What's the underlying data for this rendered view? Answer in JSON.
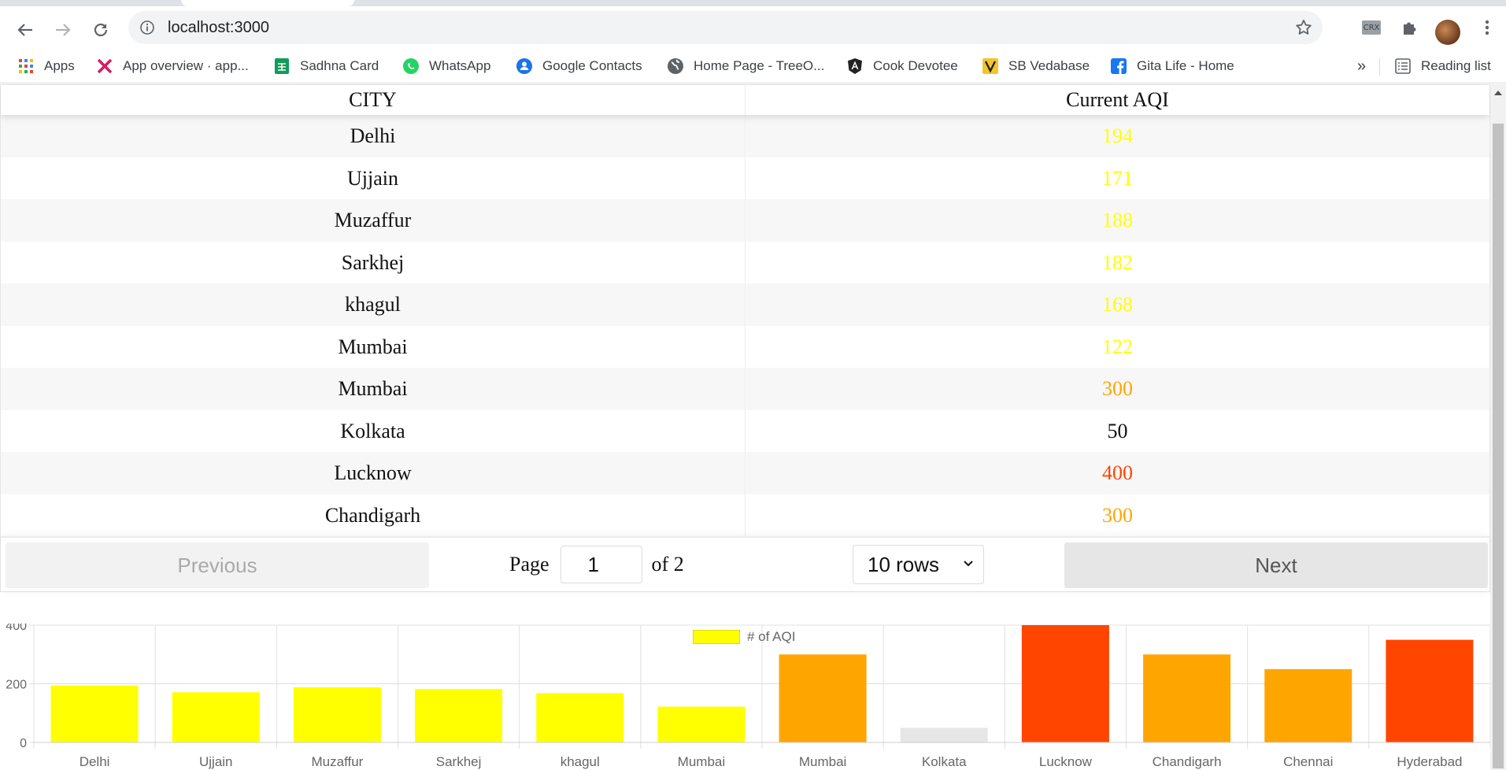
{
  "browser": {
    "url": "localhost:3000",
    "bookmarks": [
      {
        "label": "Apps",
        "icon": "apps-grid-icon"
      },
      {
        "label": "App overview · app...",
        "icon": "app-overview-icon"
      },
      {
        "label": "Sadhna Card",
        "icon": "sheets-icon"
      },
      {
        "label": "WhatsApp",
        "icon": "whatsapp-icon"
      },
      {
        "label": "Google Contacts",
        "icon": "contacts-icon"
      },
      {
        "label": "Home Page - TreeO...",
        "icon": "globe-icon"
      },
      {
        "label": "Cook Devotee",
        "icon": "angular-icon"
      },
      {
        "label": "SB Vedabase",
        "icon": "vedabase-icon"
      },
      {
        "label": "Gita Life - Home",
        "icon": "facebook-icon"
      }
    ],
    "overflow_label": "»",
    "reading_list_label": "Reading list",
    "extension_label": "CRX"
  },
  "table": {
    "headers": [
      "CITY",
      "Current AQI"
    ],
    "rows": [
      {
        "city": "Delhi",
        "aqi": "194",
        "color": "#ffff00"
      },
      {
        "city": "Ujjain",
        "aqi": "171",
        "color": "#ffff00"
      },
      {
        "city": "Muzaffur",
        "aqi": "188",
        "color": "#ffff00"
      },
      {
        "city": "Sarkhej",
        "aqi": "182",
        "color": "#ffff00"
      },
      {
        "city": "khagul",
        "aqi": "168",
        "color": "#ffff00"
      },
      {
        "city": "Mumbai",
        "aqi": "122",
        "color": "#ffff00"
      },
      {
        "city": "Mumbai",
        "aqi": "300",
        "color": "#ffa500"
      },
      {
        "city": "Kolkata",
        "aqi": "50",
        "color": "#111111"
      },
      {
        "city": "Lucknow",
        "aqi": "400",
        "color": "#ff4500"
      },
      {
        "city": "Chandigarh",
        "aqi": "300",
        "color": "#ffa500"
      }
    ]
  },
  "pagination": {
    "previous_label": "Previous",
    "next_label": "Next",
    "page_label": "Page",
    "current_page": "1",
    "of_label": "of 2",
    "rows_option": "10 rows"
  },
  "chart_data": {
    "type": "bar",
    "legend": "# of AQI",
    "legend_color": "#ffff00",
    "categories": [
      "Delhi",
      "Ujjain",
      "Muzaffur",
      "Sarkhej",
      "khagul",
      "Mumbai",
      "Mumbai",
      "Kolkata",
      "Lucknow",
      "Chandigarh",
      "Chennai",
      "Hyderabad"
    ],
    "values": [
      194,
      171,
      188,
      182,
      168,
      122,
      300,
      50,
      400,
      300,
      250,
      350
    ],
    "colors": [
      "#ffff00",
      "#ffff00",
      "#ffff00",
      "#ffff00",
      "#ffff00",
      "#ffff00",
      "#ffa500",
      "#e6e6e6",
      "#ff4500",
      "#ffa500",
      "#ffa500",
      "#ff4500"
    ],
    "yticks": [
      "0",
      "200",
      "400"
    ],
    "ylim": [
      0,
      400
    ],
    "grid": true,
    "legend_position": "top-center"
  }
}
